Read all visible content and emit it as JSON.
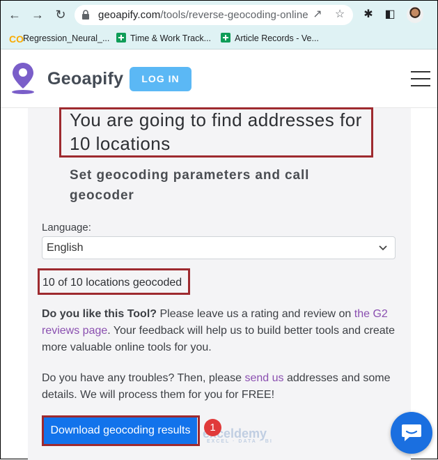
{
  "browser": {
    "url_domain": "geoapify.com",
    "url_path": "/tools/reverse-geocoding-online",
    "bookmarks": [
      {
        "label": "Regression_Neural_...",
        "icon": "colab-icon"
      },
      {
        "label": "Time & Work Track...",
        "icon": "sheets-icon"
      },
      {
        "label": "Article Records - Ve...",
        "icon": "sheets-icon"
      }
    ]
  },
  "header": {
    "brand": "Geoapify",
    "login_label": "LOG IN"
  },
  "main": {
    "title": "You are going to find addresses for 10 locations",
    "subtitle": "Set geocoding parameters and call geocoder",
    "language_label": "Language:",
    "language_value": "English",
    "status": "10 of 10 locations geocoded",
    "feedback": {
      "bold": "Do you like this Tool?",
      "text1": " Please leave us a rating and review on ",
      "link": "the G2 reviews page",
      "text2": ". Your feedback will help us to build better tools and create more valuable online tools for you."
    },
    "trouble": {
      "text1": "Do you have any troubles? Then, please ",
      "link": "send us",
      "text2": " addresses and some details. We will process them for you for FREE!"
    },
    "download_label": "Download geocoding results"
  },
  "annotation": {
    "step_number": "1"
  },
  "watermark": {
    "name": "exceldemy",
    "tagline": "EXCEL · DATA · BI"
  },
  "colors": {
    "accent": "#1273eb",
    "login": "#5bb8f5",
    "highlight": "#9e2a2f",
    "brand_logo": "#7a5ec9"
  }
}
